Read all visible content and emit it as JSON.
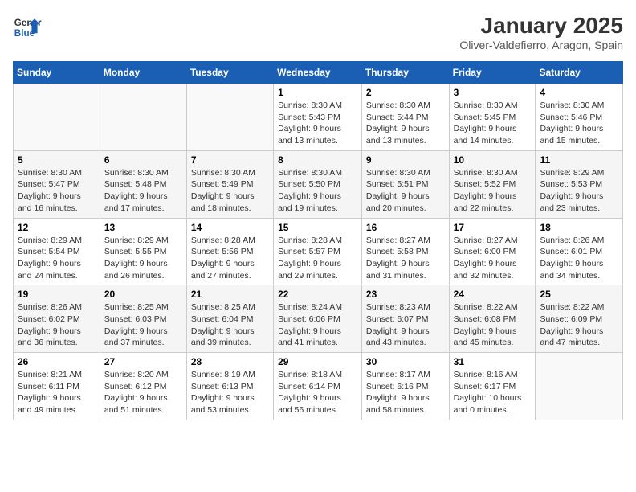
{
  "logo": {
    "line1": "General",
    "line2": "Blue"
  },
  "title": "January 2025",
  "subtitle": "Oliver-Valdefierro, Aragon, Spain",
  "days_header": [
    "Sunday",
    "Monday",
    "Tuesday",
    "Wednesday",
    "Thursday",
    "Friday",
    "Saturday"
  ],
  "weeks": [
    [
      {
        "day": "",
        "content": ""
      },
      {
        "day": "",
        "content": ""
      },
      {
        "day": "",
        "content": ""
      },
      {
        "day": "1",
        "content": "Sunrise: 8:30 AM\nSunset: 5:43 PM\nDaylight: 9 hours and 13 minutes."
      },
      {
        "day": "2",
        "content": "Sunrise: 8:30 AM\nSunset: 5:44 PM\nDaylight: 9 hours and 13 minutes."
      },
      {
        "day": "3",
        "content": "Sunrise: 8:30 AM\nSunset: 5:45 PM\nDaylight: 9 hours and 14 minutes."
      },
      {
        "day": "4",
        "content": "Sunrise: 8:30 AM\nSunset: 5:46 PM\nDaylight: 9 hours and 15 minutes."
      }
    ],
    [
      {
        "day": "5",
        "content": "Sunrise: 8:30 AM\nSunset: 5:47 PM\nDaylight: 9 hours and 16 minutes."
      },
      {
        "day": "6",
        "content": "Sunrise: 8:30 AM\nSunset: 5:48 PM\nDaylight: 9 hours and 17 minutes."
      },
      {
        "day": "7",
        "content": "Sunrise: 8:30 AM\nSunset: 5:49 PM\nDaylight: 9 hours and 18 minutes."
      },
      {
        "day": "8",
        "content": "Sunrise: 8:30 AM\nSunset: 5:50 PM\nDaylight: 9 hours and 19 minutes."
      },
      {
        "day": "9",
        "content": "Sunrise: 8:30 AM\nSunset: 5:51 PM\nDaylight: 9 hours and 20 minutes."
      },
      {
        "day": "10",
        "content": "Sunrise: 8:30 AM\nSunset: 5:52 PM\nDaylight: 9 hours and 22 minutes."
      },
      {
        "day": "11",
        "content": "Sunrise: 8:29 AM\nSunset: 5:53 PM\nDaylight: 9 hours and 23 minutes."
      }
    ],
    [
      {
        "day": "12",
        "content": "Sunrise: 8:29 AM\nSunset: 5:54 PM\nDaylight: 9 hours and 24 minutes."
      },
      {
        "day": "13",
        "content": "Sunrise: 8:29 AM\nSunset: 5:55 PM\nDaylight: 9 hours and 26 minutes."
      },
      {
        "day": "14",
        "content": "Sunrise: 8:28 AM\nSunset: 5:56 PM\nDaylight: 9 hours and 27 minutes."
      },
      {
        "day": "15",
        "content": "Sunrise: 8:28 AM\nSunset: 5:57 PM\nDaylight: 9 hours and 29 minutes."
      },
      {
        "day": "16",
        "content": "Sunrise: 8:27 AM\nSunset: 5:58 PM\nDaylight: 9 hours and 31 minutes."
      },
      {
        "day": "17",
        "content": "Sunrise: 8:27 AM\nSunset: 6:00 PM\nDaylight: 9 hours and 32 minutes."
      },
      {
        "day": "18",
        "content": "Sunrise: 8:26 AM\nSunset: 6:01 PM\nDaylight: 9 hours and 34 minutes."
      }
    ],
    [
      {
        "day": "19",
        "content": "Sunrise: 8:26 AM\nSunset: 6:02 PM\nDaylight: 9 hours and 36 minutes."
      },
      {
        "day": "20",
        "content": "Sunrise: 8:25 AM\nSunset: 6:03 PM\nDaylight: 9 hours and 37 minutes."
      },
      {
        "day": "21",
        "content": "Sunrise: 8:25 AM\nSunset: 6:04 PM\nDaylight: 9 hours and 39 minutes."
      },
      {
        "day": "22",
        "content": "Sunrise: 8:24 AM\nSunset: 6:06 PM\nDaylight: 9 hours and 41 minutes."
      },
      {
        "day": "23",
        "content": "Sunrise: 8:23 AM\nSunset: 6:07 PM\nDaylight: 9 hours and 43 minutes."
      },
      {
        "day": "24",
        "content": "Sunrise: 8:22 AM\nSunset: 6:08 PM\nDaylight: 9 hours and 45 minutes."
      },
      {
        "day": "25",
        "content": "Sunrise: 8:22 AM\nSunset: 6:09 PM\nDaylight: 9 hours and 47 minutes."
      }
    ],
    [
      {
        "day": "26",
        "content": "Sunrise: 8:21 AM\nSunset: 6:11 PM\nDaylight: 9 hours and 49 minutes."
      },
      {
        "day": "27",
        "content": "Sunrise: 8:20 AM\nSunset: 6:12 PM\nDaylight: 9 hours and 51 minutes."
      },
      {
        "day": "28",
        "content": "Sunrise: 8:19 AM\nSunset: 6:13 PM\nDaylight: 9 hours and 53 minutes."
      },
      {
        "day": "29",
        "content": "Sunrise: 8:18 AM\nSunset: 6:14 PM\nDaylight: 9 hours and 56 minutes."
      },
      {
        "day": "30",
        "content": "Sunrise: 8:17 AM\nSunset: 6:16 PM\nDaylight: 9 hours and 58 minutes."
      },
      {
        "day": "31",
        "content": "Sunrise: 8:16 AM\nSunset: 6:17 PM\nDaylight: 10 hours and 0 minutes."
      },
      {
        "day": "",
        "content": ""
      }
    ]
  ]
}
